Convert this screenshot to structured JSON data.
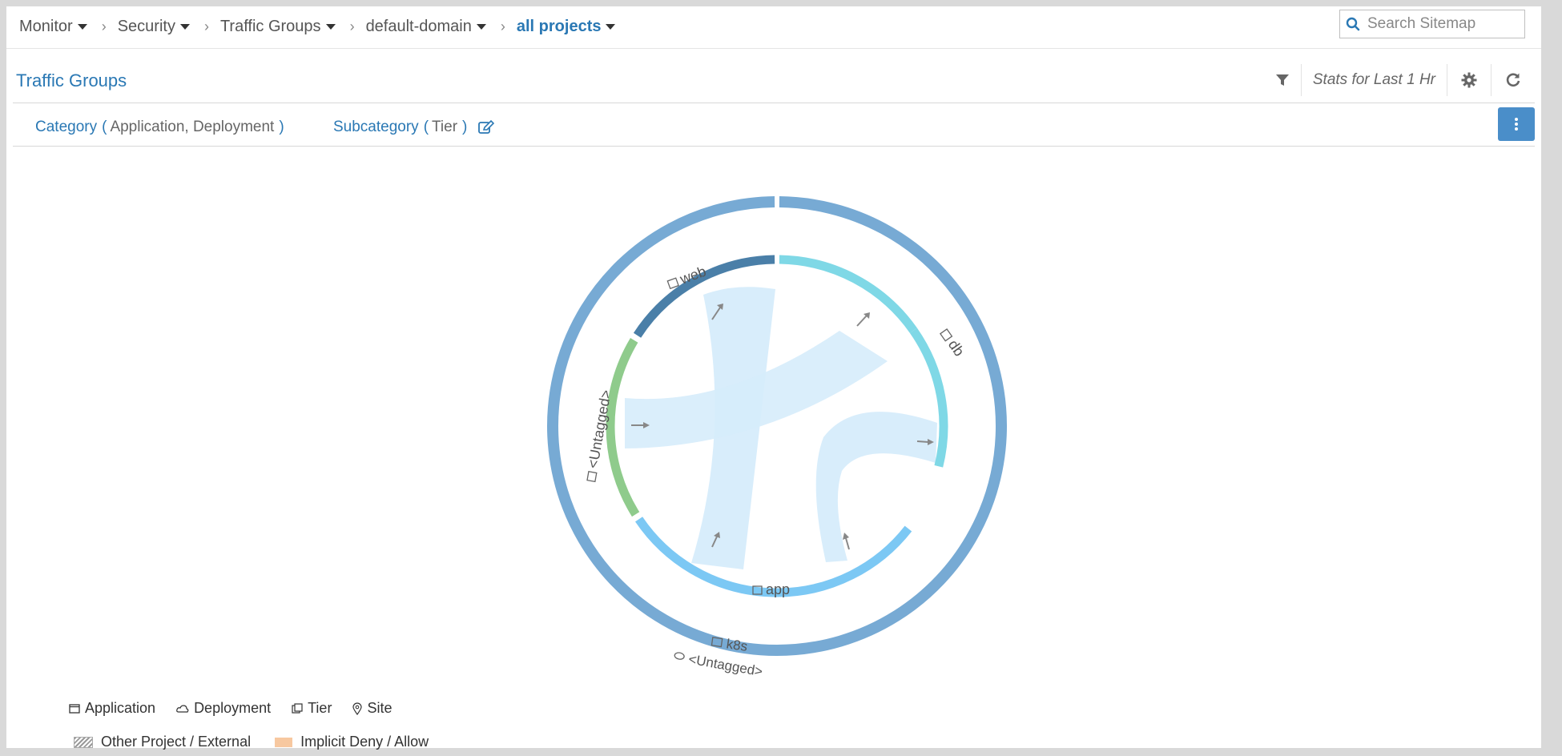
{
  "breadcrumbs": [
    {
      "label": "Monitor"
    },
    {
      "label": "Security"
    },
    {
      "label": "Traffic Groups"
    },
    {
      "label": "default-domain"
    },
    {
      "label": "all projects"
    }
  ],
  "search": {
    "placeholder": "Search Sitemap"
  },
  "page_title": "Traffic Groups",
  "toolbar": {
    "stats_label": "Stats for Last 1 Hr"
  },
  "category": {
    "label": "Category",
    "value": "Application, Deployment",
    "sub_label": "Subcategory",
    "sub_value": "Tier"
  },
  "chart": {
    "outer_labels": [
      "k8s",
      "<Untagged>"
    ],
    "segments": [
      {
        "name": "web",
        "color": "#4a7fa8"
      },
      {
        "name": "db",
        "color": "#7fd8e6"
      },
      {
        "name": "app",
        "color": "#7cc8f4"
      },
      {
        "name": "<Untagged>",
        "color": "#8fcb8c"
      }
    ],
    "outer_ring_color": "#77aad4",
    "ribbon_color": "#d6ecfb"
  },
  "legend": {
    "items": [
      {
        "name": "Application",
        "icon": "application-icon"
      },
      {
        "name": "Deployment",
        "icon": "deployment-icon"
      },
      {
        "name": "Tier",
        "icon": "tier-icon"
      },
      {
        "name": "Site",
        "icon": "site-icon"
      }
    ],
    "other_project": "Other Project / External",
    "implicit": "Implicit Deny / Allow"
  },
  "colors": {
    "accent": "#2a78b4",
    "button": "#4a8ec9"
  }
}
